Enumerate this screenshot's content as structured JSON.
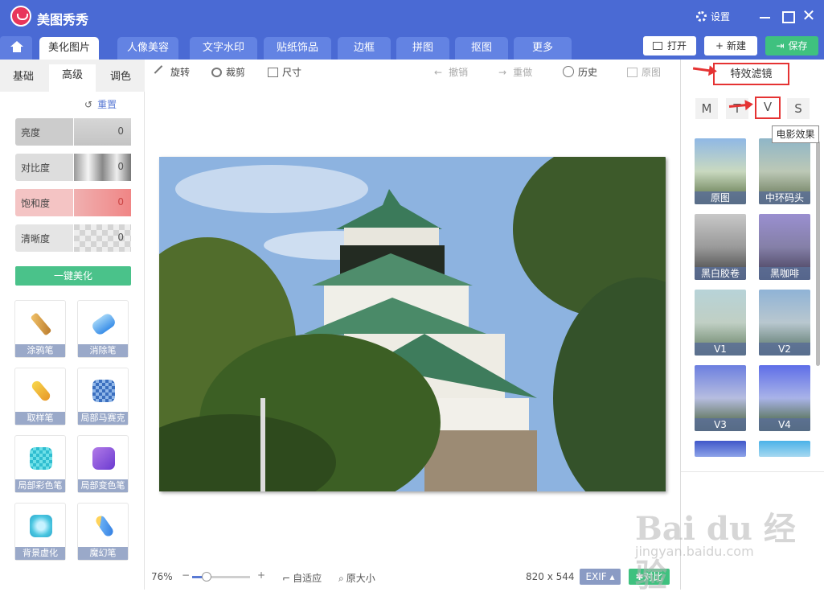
{
  "app": {
    "title": "美图秀秀",
    "settings_label": "设置"
  },
  "nav": {
    "tabs": [
      "美化图片",
      "人像美容",
      "文字水印",
      "贴纸饰品",
      "边框",
      "拼图",
      "抠图",
      "更多"
    ],
    "open_label": "打开",
    "new_label": "新建",
    "save_label": "保存"
  },
  "left": {
    "tabs": [
      "基础",
      "高级",
      "调色"
    ],
    "reset_label": "重置",
    "sliders": [
      {
        "label": "亮度",
        "value": "0"
      },
      {
        "label": "对比度",
        "value": "0"
      },
      {
        "label": "饱和度",
        "value": "0"
      },
      {
        "label": "清晰度",
        "value": "0"
      }
    ],
    "onekey_label": "一键美化",
    "tools": [
      "涂鸦笔",
      "消除笔",
      "取样笔",
      "局部马赛克",
      "局部彩色笔",
      "局部变色笔",
      "背景虚化",
      "魔幻笔"
    ]
  },
  "toolbar": {
    "rotate": "旋转",
    "crop": "裁剪",
    "size": "尺寸",
    "undo": "撤销",
    "redo": "重做",
    "history": "历史",
    "original": "原图"
  },
  "status": {
    "zoom": "76%",
    "fit_label": "自适应",
    "actual_label": "原大小",
    "dimensions": "820 x 544",
    "exif_label": "EXIF",
    "compare_label": "对比"
  },
  "right": {
    "title": "特效滤镜",
    "tabs": [
      "M",
      "T",
      "V",
      "S"
    ],
    "tooltip": "电影效果",
    "filters": [
      "原图",
      "中环码头",
      "黑白胶卷",
      "黑咖啡",
      "V1",
      "V2",
      "V3",
      "V4"
    ]
  },
  "watermark": {
    "brand": "Bai du 经验",
    "url": "jingyan.baidu.com"
  }
}
